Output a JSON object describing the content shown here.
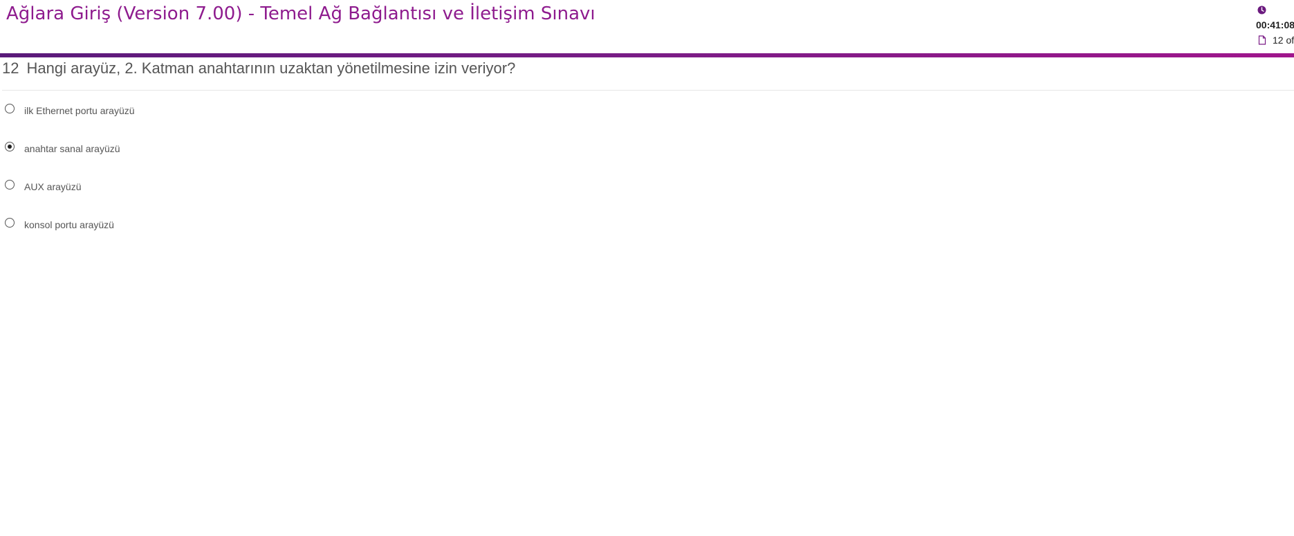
{
  "header": {
    "title": "Ağlara Giriş (Version 7.00) - Temel Ağ Bağlantısı ve İletişim Sınavı",
    "timer": "00:41:08",
    "progress": "12 of",
    "clock_icon": "clock-icon",
    "doc_icon": "document-icon"
  },
  "colors": {
    "brand": "#8e1b8e",
    "accent_bar_start": "#5a1a7a",
    "accent_bar_end": "#a0168c"
  },
  "question": {
    "number": "12",
    "text": "Hangi arayüz, 2. Katman anahtarının uzaktan yönetilmesine izin veriyor?",
    "options": [
      {
        "label": "ilk Ethernet portu arayüzü",
        "selected": false
      },
      {
        "label": "anahtar sanal arayüzü",
        "selected": true
      },
      {
        "label": "AUX arayüzü",
        "selected": false
      },
      {
        "label": "konsol portu arayüzü",
        "selected": false
      }
    ]
  }
}
